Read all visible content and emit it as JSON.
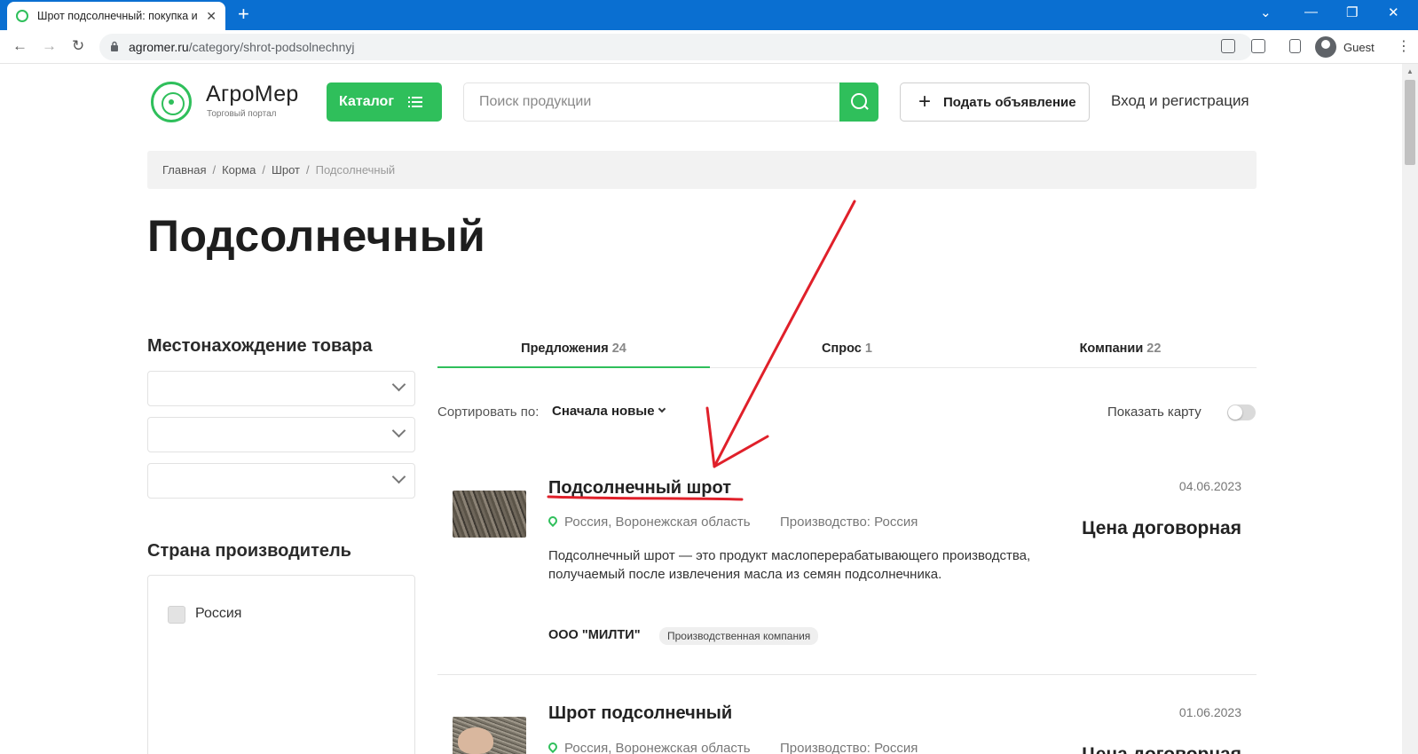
{
  "browser": {
    "tab_title": "Шрот подсолнечный: покупка и",
    "url_host": "agromer.ru",
    "url_path": "/category/shrot-podsolnechnyj",
    "profile_name": "Guest"
  },
  "header": {
    "brand_name": "АгроМер",
    "brand_sub": "Торговый портал",
    "catalog_label": "Каталог",
    "search_placeholder": "Поиск продукции",
    "post_ad_label": "Подать объявление",
    "login_label": "Вход и регистрация"
  },
  "breadcrumb": [
    "Главная",
    "Корма",
    "Шрот",
    "Подсолнечный"
  ],
  "page_title": "Подсолнечный",
  "sidebar": {
    "location_heading": "Местонахождение товара",
    "country_heading": "Страна производитель",
    "country_option": "Россия"
  },
  "tabs": [
    {
      "label": "Предложения",
      "count": "24",
      "active": true
    },
    {
      "label": "Спрос",
      "count": "1",
      "active": false
    },
    {
      "label": "Компании",
      "count": "22",
      "active": false
    }
  ],
  "sort": {
    "label": "Сортировать по:",
    "value": "Сначала новые"
  },
  "map_label": "Показать карту",
  "listings": [
    {
      "title": "Подсолнечный шрот",
      "date": "04.06.2023",
      "location": "Россия, Воронежская область",
      "production": "Производство: Россия",
      "price": "Цена договорная",
      "description": "Подсолнечный шрот — это продукт маслоперерабатывающего производства, получаемый после извлечения масла из семян подсолнечника.",
      "company": "ООО \"МИЛТИ\"",
      "company_type": "Производственная компания"
    },
    {
      "title": "Шрот подсолнечный",
      "date": "01.06.2023",
      "location": "Россия, Воронежская область",
      "production": "Производство: Россия",
      "price": "Цена договорная"
    }
  ],
  "colors": {
    "accent": "#2fbf5b",
    "browser_bar": "#0a6fd1",
    "annotation": "#e0202a"
  }
}
